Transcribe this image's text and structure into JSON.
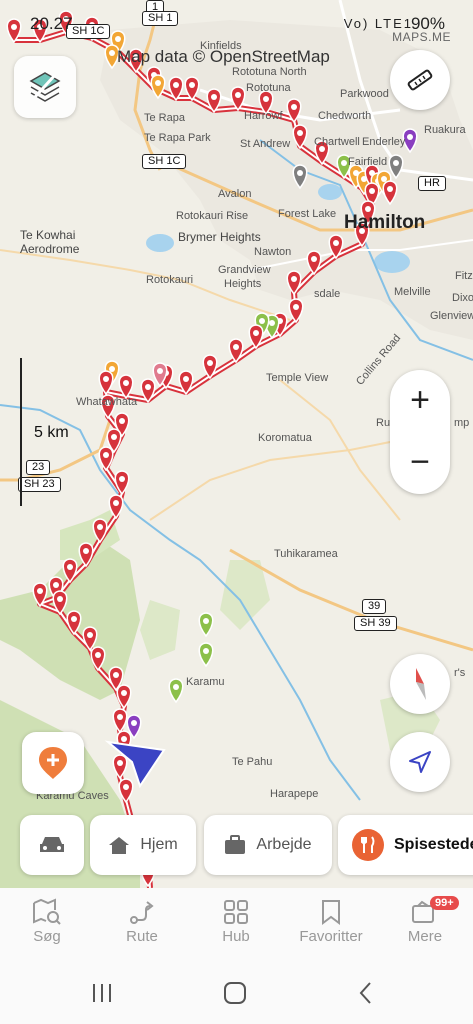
{
  "status_bar": {
    "time": "20.27",
    "signal_text": "Vo) LTE1",
    "battery": "90%"
  },
  "map": {
    "attribution": "Map data © OpenStreetMap",
    "brand": "MAPS.ME",
    "scale_label": "5 km",
    "places": {
      "kinfields": "Kinfields",
      "rototuna_north": "Rototuna North",
      "rototuna": "Rototuna",
      "parkwood": "Parkwood",
      "te_rapa": "Te Rapa",
      "te_rapa_park": "Te Rapa Park",
      "chedworth": "Chedworth",
      "st_andrews": "St Andrew",
      "chartwell": "Chartwell",
      "enderley": "Enderley",
      "ruakura": "Ruakura",
      "fairfield": "Fairfield",
      "harrowfield": "Harrowf",
      "avalon": "Avalon",
      "forest_lake": "Forest Lake",
      "hamilton": "Hamilton",
      "te_kowhai": "Te Kowhai",
      "aerodrome": "Aerodrome",
      "rotokauri_rise": "Rotokauri Rise",
      "brymer_heights": "Brymer Heights",
      "nawton": "Nawton",
      "rotokauri": "Rotokauri",
      "grandview_heights_1": "Grandview",
      "grandview_heights_2": "Heights",
      "dinsdale": "sdale",
      "melville": "Melville",
      "glenview": "Glenview",
      "fitz": "Fitz",
      "dixo": "Dixo",
      "temple_view": "Temple View",
      "collins_road": "Collins Road",
      "whatawhata": "Whatawhata",
      "koromatua": "Koromatua",
      "tuhikaramea": "Tuhikaramea",
      "karamu": "Karamu",
      "te_pahu": "Te Pahu",
      "harapepe": "Harapepe",
      "karamu_caves": "Karamu Caves",
      "aerfs": "r's",
      "ru": "Ru",
      "mp": "mp"
    },
    "shields": {
      "sh1": "SH 1",
      "sh1_top": "1",
      "sh1c_a": "SH 1C",
      "sh1c_b": "SH 1C",
      "hr": "HR",
      "sh23_num": "23",
      "sh23": "SH 23",
      "sh39_num": "39",
      "sh39": "SH 39"
    }
  },
  "controls": {
    "zoom_in": "+",
    "zoom_out": "−"
  },
  "chips": [
    {
      "label": "",
      "icon": "car-icon"
    },
    {
      "label": "Hjem",
      "icon": "home-icon"
    },
    {
      "label": "Arbejde",
      "icon": "briefcase-icon"
    },
    {
      "label": "Spisesteder",
      "icon": "restaurant-icon"
    }
  ],
  "nav": {
    "search": "Søg",
    "route": "Rute",
    "hub": "Hub",
    "favorites": "Favoritter",
    "more": "Mere",
    "more_badge": "99+"
  },
  "colors": {
    "pin_red": "#d6333c",
    "route_red": "#d8323c",
    "pin_green": "#8cc04a",
    "pin_orange": "#f2a635",
    "pin_purple": "#8a3ec0",
    "pin_gray": "#7f7f7f",
    "accent_blue": "#3b44c4",
    "compass_red": "#e0504c"
  }
}
